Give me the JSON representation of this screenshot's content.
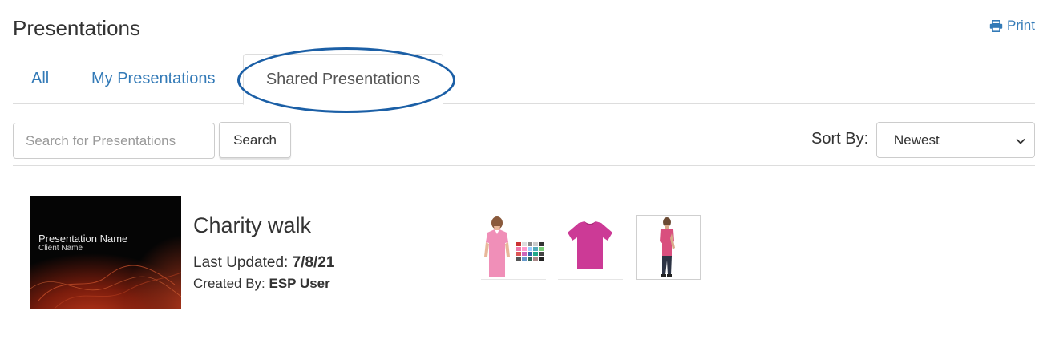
{
  "header": {
    "title": "Presentations",
    "print_label": "Print",
    "print_icon": "printer-icon"
  },
  "tabs": [
    {
      "label": "All",
      "active": false
    },
    {
      "label": "My Presentations",
      "active": false
    },
    {
      "label": "Shared Presentations",
      "active": true
    }
  ],
  "search": {
    "placeholder": "Search for Presentations",
    "value": "",
    "button_label": "Search"
  },
  "sort": {
    "label": "Sort By:",
    "selected": "Newest"
  },
  "presentations": [
    {
      "thumbnail": {
        "name": "Presentation Name",
        "client": "Client Name"
      },
      "title": "Charity walk",
      "last_updated_label": "Last Updated: ",
      "last_updated_value": "7/8/21",
      "created_by_label": "Created By: ",
      "created_by_value": "ESP User",
      "products": [
        {
          "icon": "pink-vneck-tshirt-with-swatches"
        },
        {
          "icon": "magenta-tshirt"
        },
        {
          "icon": "man-in-pink-tshirt"
        }
      ]
    }
  ],
  "colors": {
    "link": "#337ab7",
    "annotation_ellipse": "#1b5fa6",
    "text": "#333333",
    "border": "#dddddd"
  }
}
